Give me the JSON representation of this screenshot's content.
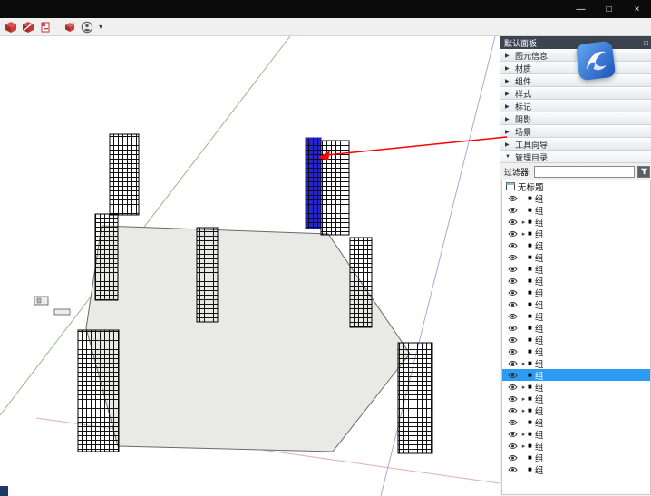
{
  "titlebar": {
    "minimize": "—",
    "maximize": "□",
    "close": "×"
  },
  "toolbar": {
    "dropdown": "▾"
  },
  "icons": {
    "collapsed": "▶",
    "expanded": "▼",
    "item_arrow": "▸",
    "group_square": "■"
  },
  "panel": {
    "title": "默认面板",
    "pin": "□",
    "sections": [
      {
        "label": "图元信息",
        "expanded": false
      },
      {
        "label": "材质",
        "expanded": false
      },
      {
        "label": "组件",
        "expanded": false
      },
      {
        "label": "样式",
        "expanded": false
      },
      {
        "label": "标记",
        "expanded": false
      },
      {
        "label": "阴影",
        "expanded": false
      },
      {
        "label": "场景",
        "expanded": false
      },
      {
        "label": "工具向导",
        "expanded": false
      },
      {
        "label": "管理目录",
        "expanded": true
      }
    ],
    "filter": {
      "label": "过滤器:",
      "value": "",
      "placeholder": ""
    },
    "outliner": {
      "root": "无标题",
      "items": [
        {
          "label": "组",
          "arrow": false,
          "selected": false
        },
        {
          "label": "组",
          "arrow": false,
          "selected": false
        },
        {
          "label": "组",
          "arrow": true,
          "selected": false
        },
        {
          "label": "组",
          "arrow": true,
          "selected": false
        },
        {
          "label": "组",
          "arrow": false,
          "selected": false
        },
        {
          "label": "组",
          "arrow": false,
          "selected": false
        },
        {
          "label": "组",
          "arrow": false,
          "selected": false
        },
        {
          "label": "组",
          "arrow": false,
          "selected": false
        },
        {
          "label": "组",
          "arrow": false,
          "selected": false
        },
        {
          "label": "组",
          "arrow": false,
          "selected": false
        },
        {
          "label": "组",
          "arrow": false,
          "selected": false
        },
        {
          "label": "组",
          "arrow": false,
          "selected": false
        },
        {
          "label": "组",
          "arrow": false,
          "selected": false
        },
        {
          "label": "组",
          "arrow": false,
          "selected": false
        },
        {
          "label": "组",
          "arrow": true,
          "selected": false
        },
        {
          "label": "组",
          "arrow": false,
          "selected": true
        },
        {
          "label": "组",
          "arrow": true,
          "selected": false
        },
        {
          "label": "组",
          "arrow": true,
          "selected": false
        },
        {
          "label": "组",
          "arrow": true,
          "selected": false
        },
        {
          "label": "组",
          "arrow": false,
          "selected": false
        },
        {
          "label": "组",
          "arrow": true,
          "selected": false
        },
        {
          "label": "组",
          "arrow": true,
          "selected": false
        },
        {
          "label": "组",
          "arrow": false,
          "selected": false
        },
        {
          "label": "组",
          "arrow": false,
          "selected": false
        }
      ]
    }
  },
  "colors": {
    "selection": "#2e9bf2",
    "selected_column": "#2525d8",
    "annotation": "#ff0000",
    "panel_header": "#3d4450"
  }
}
